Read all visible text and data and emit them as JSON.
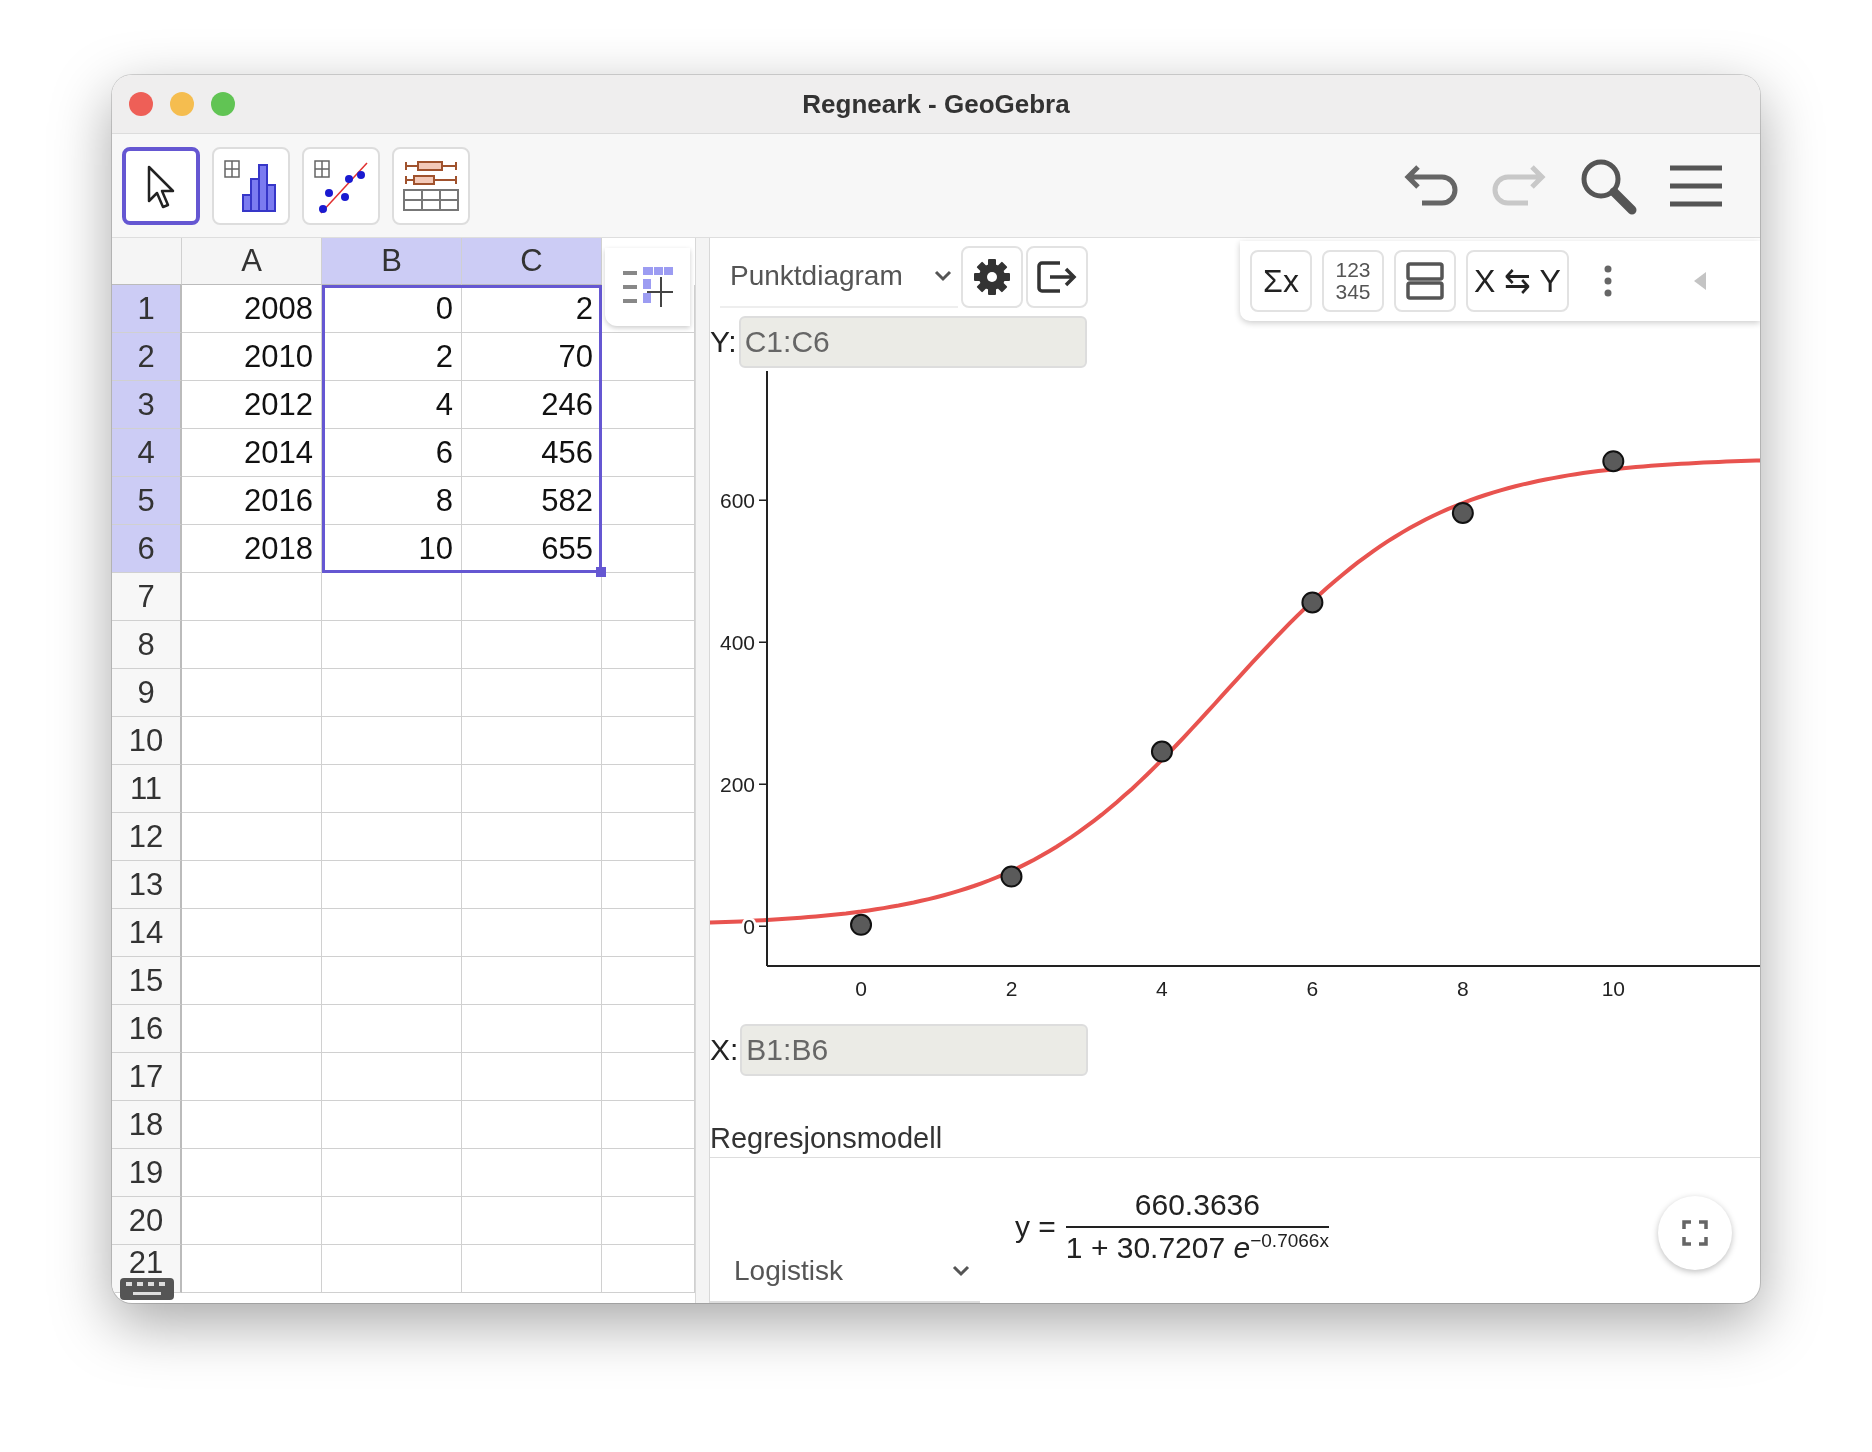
{
  "window": {
    "title": "Regneark - GeoGebra"
  },
  "toolbar": {
    "tools": [
      {
        "kind": "move",
        "selected": true
      },
      {
        "kind": "histogram",
        "selected": false
      },
      {
        "kind": "scatter",
        "selected": false
      },
      {
        "kind": "boxplot",
        "selected": false
      }
    ],
    "actions": [
      {
        "kind": "undo",
        "disabled": false
      },
      {
        "kind": "redo",
        "disabled": true
      },
      {
        "kind": "search",
        "disabled": false
      },
      {
        "kind": "menu",
        "disabled": false
      }
    ]
  },
  "spreadsheet": {
    "columns": [
      {
        "label": "A",
        "selected": false
      },
      {
        "label": "B",
        "selected": true
      },
      {
        "label": "C",
        "selected": true
      }
    ],
    "rows": [
      {
        "label": "1",
        "selected": true,
        "cells": [
          "2008",
          "0",
          "2"
        ]
      },
      {
        "label": "2",
        "selected": true,
        "cells": [
          "2010",
          "2",
          "70"
        ]
      },
      {
        "label": "3",
        "selected": true,
        "cells": [
          "2012",
          "4",
          "246"
        ]
      },
      {
        "label": "4",
        "selected": true,
        "cells": [
          "2014",
          "6",
          "456"
        ]
      },
      {
        "label": "5",
        "selected": true,
        "cells": [
          "2016",
          "8",
          "582"
        ]
      },
      {
        "label": "6",
        "selected": true,
        "cells": [
          "2018",
          "10",
          "655"
        ]
      },
      {
        "label": "7",
        "selected": false
      },
      {
        "label": "8",
        "selected": false
      },
      {
        "label": "9",
        "selected": false
      },
      {
        "label": "10",
        "selected": false
      },
      {
        "label": "11",
        "selected": false
      },
      {
        "label": "12",
        "selected": false
      },
      {
        "label": "13",
        "selected": false
      },
      {
        "label": "14",
        "selected": false
      },
      {
        "label": "15",
        "selected": false
      },
      {
        "label": "16",
        "selected": false
      },
      {
        "label": "17",
        "selected": false
      },
      {
        "label": "18",
        "selected": false
      },
      {
        "label": "19",
        "selected": false
      },
      {
        "label": "20",
        "selected": false
      },
      {
        "label": "21",
        "selected": false
      }
    ]
  },
  "plot_panel": {
    "plot_type": "Punktdiagram",
    "style_bar": [
      {
        "kind": "text",
        "label": "Σx"
      },
      {
        "kind": "stack",
        "lines": [
          "123",
          "345"
        ]
      },
      {
        "kind": "layout"
      },
      {
        "kind": "text",
        "label": "X ⇆ Y"
      },
      {
        "kind": "more"
      },
      {
        "kind": "collapse"
      }
    ],
    "y_source": {
      "label": "Y:",
      "value": "C1:C6"
    },
    "chart_data": {
      "type": "scatter",
      "x": [
        0,
        2,
        4,
        6,
        8,
        10
      ],
      "series": [
        {
          "color": "#5a5a5a",
          "values": [
            2,
            70,
            246,
            456,
            582,
            655
          ]
        }
      ],
      "xlim": [
        -1.25,
        11.95
      ],
      "ylim": [
        -56,
        782
      ],
      "xticks": [
        0,
        2,
        4,
        6,
        8,
        10
      ],
      "yticks": [
        0,
        200,
        400,
        600
      ]
    },
    "x_source": {
      "label": "X:",
      "value": "B1:B6"
    },
    "regression": {
      "heading": "Regresjonsmodell",
      "model": "Logistisk",
      "equation": {
        "lhs": "y =",
        "numerator": "660.3636",
        "denominator": "1 + 30.7207",
        "base": "e",
        "exponent": "−0.7066x"
      }
    }
  }
}
